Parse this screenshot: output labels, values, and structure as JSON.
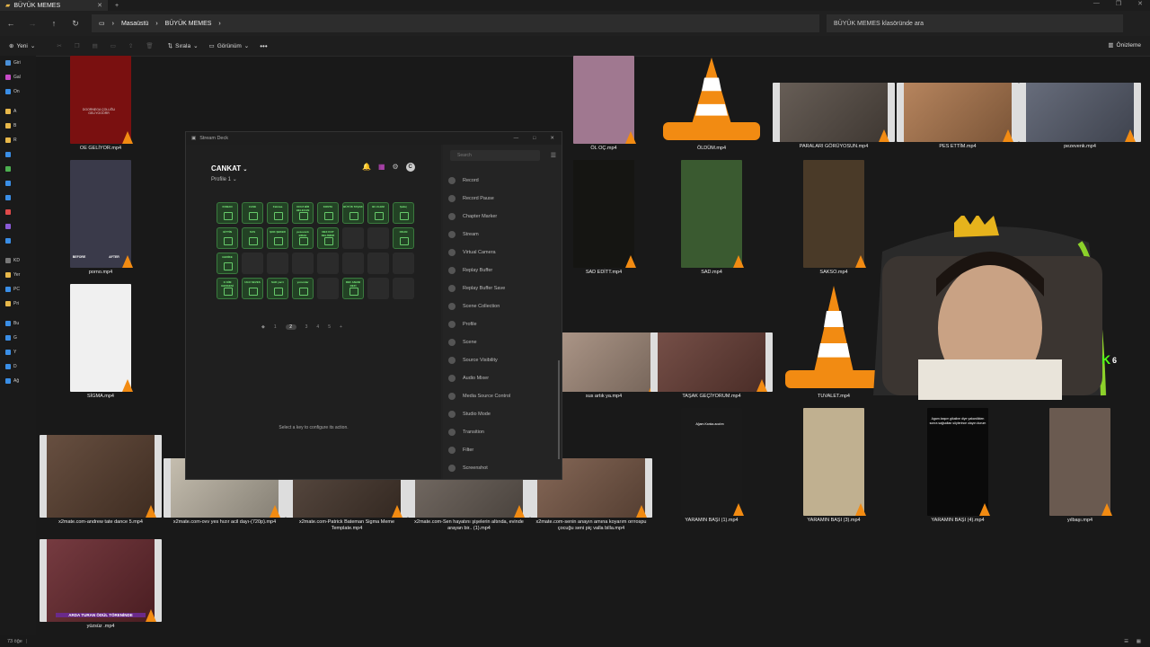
{
  "window": {
    "tab_title": "BÜYÜK MEMES",
    "new_tab": "+"
  },
  "nav": {
    "breadcrumb": [
      "Masaüstü",
      "BÜYÜK MEMES"
    ],
    "search_placeholder": "BÜYÜK MEMES klasöründe ara"
  },
  "toolbar": {
    "new_label": "Yeni",
    "sort_label": "Sırala",
    "view_label": "Görünüm",
    "more": "•••",
    "preview_label": "Önizleme"
  },
  "sidebar": {
    "items": [
      "Giri",
      "Gal",
      "On",
      "A",
      "B",
      "R",
      "",
      "",
      "",
      "",
      "",
      "",
      "",
      "KD",
      "Yer",
      "PC",
      "Pri",
      "Bu",
      "G",
      "Y",
      "D",
      "Ağ"
    ]
  },
  "status": {
    "count": "73 öğe"
  },
  "files": [
    {
      "name": "OE GELİYOR.mp4"
    },
    {
      "name": "ÖL OÇ.mp4"
    },
    {
      "name": "ÖLDÜM.mp4"
    },
    {
      "name": "PARALARI GÖRÜYOSUN.mp4"
    },
    {
      "name": "PES ETTİM.mp4"
    },
    {
      "name": "pezevenk.mp4"
    },
    {
      "name": "porno.mp4"
    },
    {
      "name": "SAD EDİTT.mp4"
    },
    {
      "name": "SAD.mp4"
    },
    {
      "name": "SAKSO.mp4"
    },
    {
      "name": "SİGMA.mp4"
    },
    {
      "name": "sus artık ya.mp4"
    },
    {
      "name": "TAŞAK GEÇİYORUM.mp4"
    },
    {
      "name": "TUVALET.mp4"
    },
    {
      "name": "x2mate.com-andrew tate dance 5.mp4"
    },
    {
      "name": "x2mate.com-ovv yes hızır acil dayı-(720p).mp4"
    },
    {
      "name": "x2mate.com-Patrick Bateman Sigma Meme Template.mp4"
    },
    {
      "name": "x2mate.com-Sen hayatını şişelerin altında, evinde arayan bir.. (1).mp4"
    },
    {
      "name": "x2mate.com-senin anayın amına koyarım orrrospu çocuğu seni piç valla billa.mp4"
    },
    {
      "name": "YARAMIN BAŞI (1).mp4"
    },
    {
      "name": "YARAMIN BAŞI (3).mp4"
    },
    {
      "name": "YARAMIN BAŞI (4).mp4"
    },
    {
      "name": "yılbaşı.mp4"
    },
    {
      "name": "yüzsüz .mp4"
    }
  ],
  "overlay_texts": {
    "oe_thumb": "DOORNEGA ÇOLUĞU GELİYOOORR",
    "before": "BEFORE",
    "after": "AFTER",
    "yaramin1": "Ağam.Kanka.acalım",
    "yaramin4": "Agam.başım gikaline diye yakardikten sonra sağsaltan söylerince olayın durum",
    "yuzsuz_banner": "ARDA TURAN ÖDÜL TÖRENİNDE",
    "webcam_badge": "6"
  },
  "stream_deck": {
    "window_title": "Stream Deck",
    "profile_owner": "CANKAT",
    "profile_name": "Profile 1",
    "search_placeholder": "Search",
    "keys": [
      "KOBAN",
      "CASE",
      "Fatmaa",
      "UCUZ BİR HELECAN",
      "KONTA",
      "BÜYÜK TAŞAK",
      "BU ALEM",
      "Şabiç",
      "GİTTİN",
      "SUS",
      "ŞOK ŞEKER",
      "pezevenk BRAH",
      "NEX KOT DELİSİNİZ",
      "",
      "",
      "OKAN",
      "GERİKE",
      "",
      "",
      "",
      "",
      "",
      "",
      "",
      "O KİM GENGESİ",
      "UGU SEVES",
      "SAD yarrr",
      "yorumlar",
      "",
      "DEF ANANI DEFİ",
      "",
      ""
    ],
    "pages": [
      "1",
      "2",
      "3",
      "4",
      "5"
    ],
    "current_page": "2",
    "hint": "Select a key to configure its action.",
    "actions": [
      "Record",
      "Record Pause",
      "Chapter Marker",
      "Stream",
      "Virtual Camera",
      "Replay Buffer",
      "Replay Buffer Save",
      "Scene Collection",
      "Profile",
      "Scene",
      "Source Visibility",
      "Audio Mixer",
      "Media Source Control",
      "Studio Mode",
      "Transition",
      "Filter",
      "Screenshot"
    ]
  },
  "colors": {
    "accent_green": "#7cf27e",
    "cone_orange": "#f28b12",
    "background": "#191919"
  }
}
